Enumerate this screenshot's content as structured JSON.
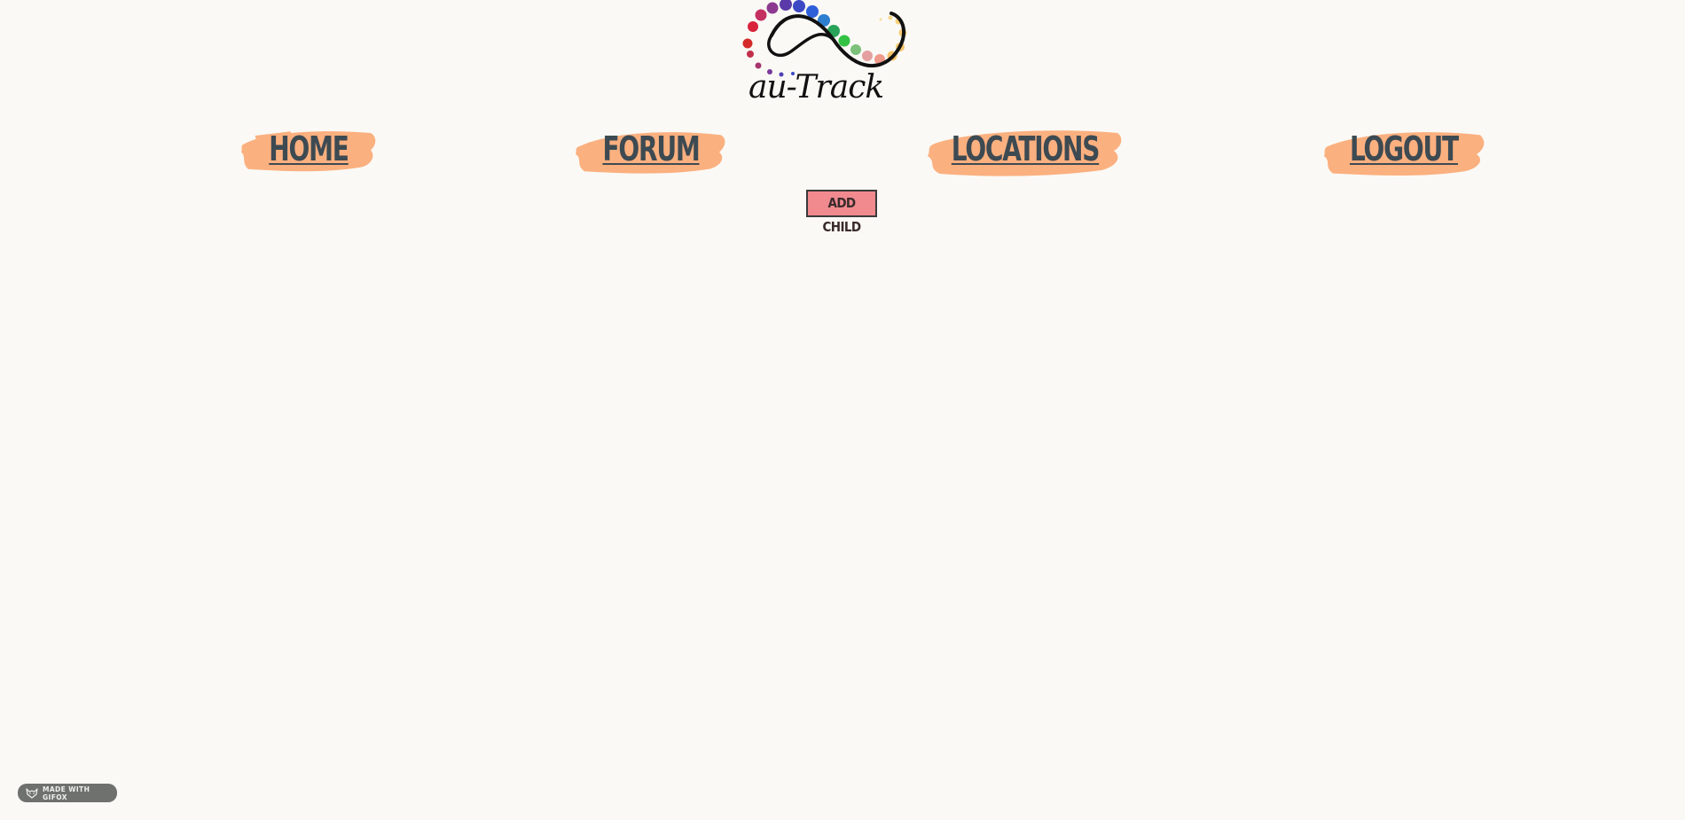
{
  "logo": {
    "alt": "au-Track",
    "text": "au-Track"
  },
  "nav": {
    "items": [
      {
        "label": "HOME"
      },
      {
        "label": "FORUM"
      },
      {
        "label": "LOCATIONS"
      },
      {
        "label": "LOGOUT"
      }
    ],
    "brush_color": "#fbb07f",
    "label_color": "#3d4a52"
  },
  "actions": {
    "add_child_label": "ADD CHILD",
    "add_child_color": "#f08a8f"
  },
  "badge": {
    "label": "MADE WITH GIFOX",
    "icon": "gifox-icon"
  }
}
